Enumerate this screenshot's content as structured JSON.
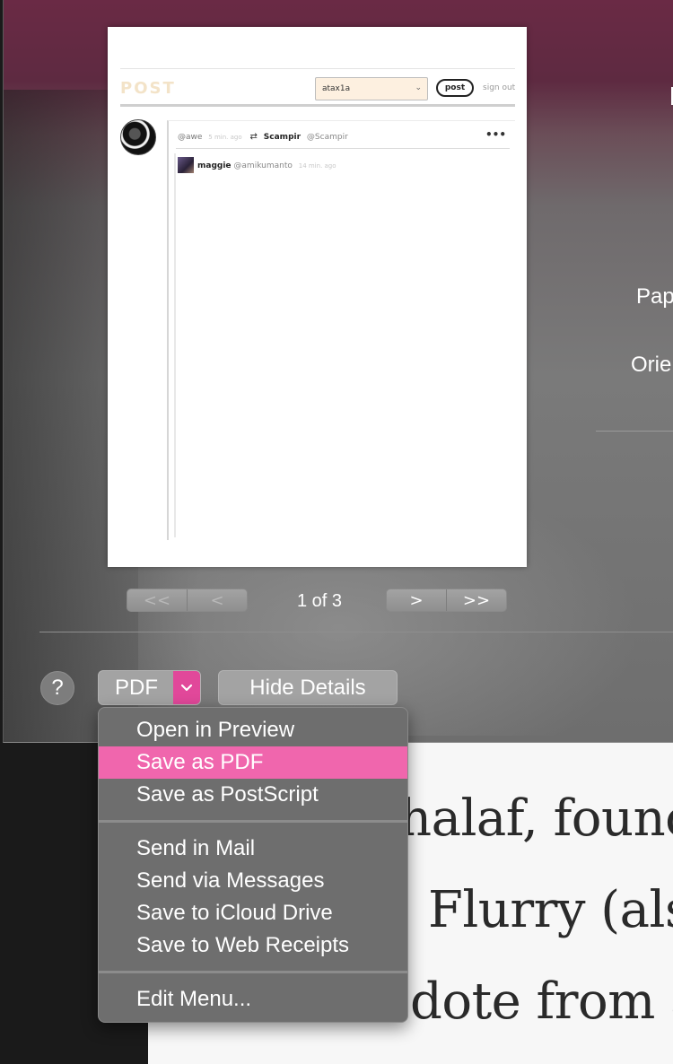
{
  "preview": {
    "logo": "POST",
    "select_value": "atax1a",
    "post_button": "post",
    "sign_out": "sign out",
    "card": {
      "handle": "@awe",
      "time": "5 min. ago",
      "reblog_name": "Scampir",
      "reblog_handle": "@Scampir",
      "more": "•••",
      "inner_name": "maggie",
      "inner_handle": "@amikumanto",
      "inner_time": "14 min. ago"
    }
  },
  "pager": {
    "first": "<<",
    "prev": "<",
    "next": ">",
    "last": ">>",
    "page_count": "1 of 3"
  },
  "side_labels": {
    "paper": "Pap",
    "orientation": "Orie"
  },
  "buttons": {
    "help": "?",
    "pdf": "PDF",
    "hide_details": "Hide Details"
  },
  "menu": {
    "group1": [
      "Open in Preview",
      "Save as PDF",
      "Save as PostScript"
    ],
    "selected": "Save as PDF",
    "group2": [
      "Send in Mail",
      "Send via Messages",
      "Save to iCloud Drive",
      "Save to Web Receipts"
    ],
    "group3": [
      "Edit Menu..."
    ]
  },
  "background_article": {
    "line1": "halaf, founc",
    "line2": "Flurry (als",
    "line3": "dote from ar"
  },
  "colors": {
    "accent": "#e1489a",
    "menu_highlight": "#f066ad",
    "dialog_top": "#6a2a45"
  }
}
